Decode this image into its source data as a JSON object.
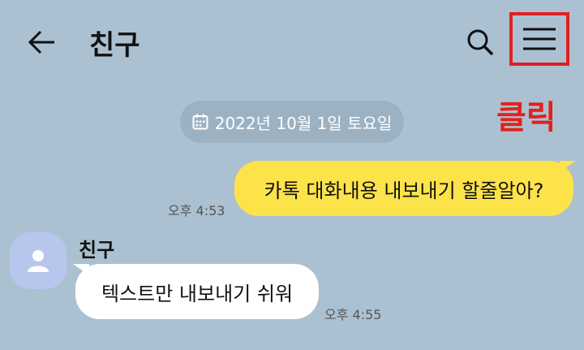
{
  "header": {
    "title": "친구",
    "back_icon": "arrow-left-icon",
    "search_icon": "search-icon",
    "menu_icon": "hamburger-menu-icon"
  },
  "annotation": {
    "label": "클릭",
    "color": "#e3201b"
  },
  "chat": {
    "date": "2022년 10월 1일 토요일",
    "messages": [
      {
        "from": "me",
        "text": "카톡 대화내용 내보내기 할줄알아?",
        "time": "오후 4:53"
      },
      {
        "from": "friend",
        "sender": "친구",
        "text": "텍스트만 내보내기 쉬워",
        "time": "오후 4:55"
      }
    ]
  },
  "colors": {
    "background": "#abc1d1",
    "my_bubble": "#fde34a",
    "friend_bubble": "#ffffff",
    "highlight": "#e02020"
  }
}
